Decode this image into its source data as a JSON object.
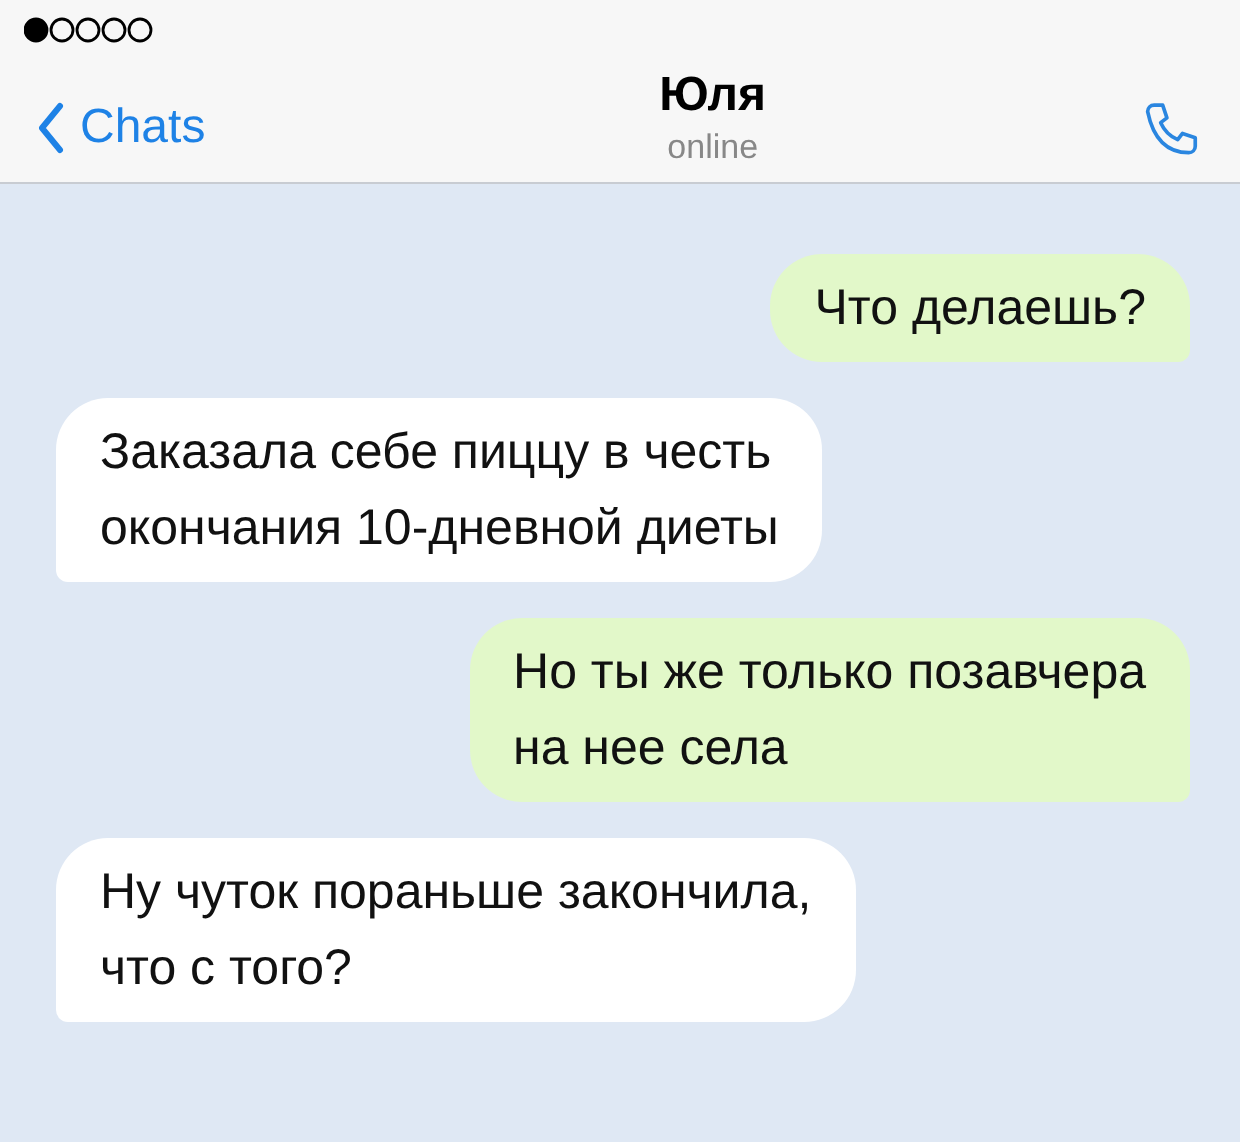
{
  "header": {
    "back_label": "Chats",
    "title": "Юля",
    "subtitle": "online"
  },
  "messages": [
    {
      "kind": "outgoing",
      "text": "Что делаешь?"
    },
    {
      "kind": "incoming",
      "text": "Заказала себе пиццу в честь\nокончания 10-дневной диеты"
    },
    {
      "kind": "outgoing",
      "text": "Но ты же только позавчера\nна нее села"
    },
    {
      "kind": "incoming",
      "text": "Ну чуток пораньше закончила,\nчто с того?"
    }
  ]
}
